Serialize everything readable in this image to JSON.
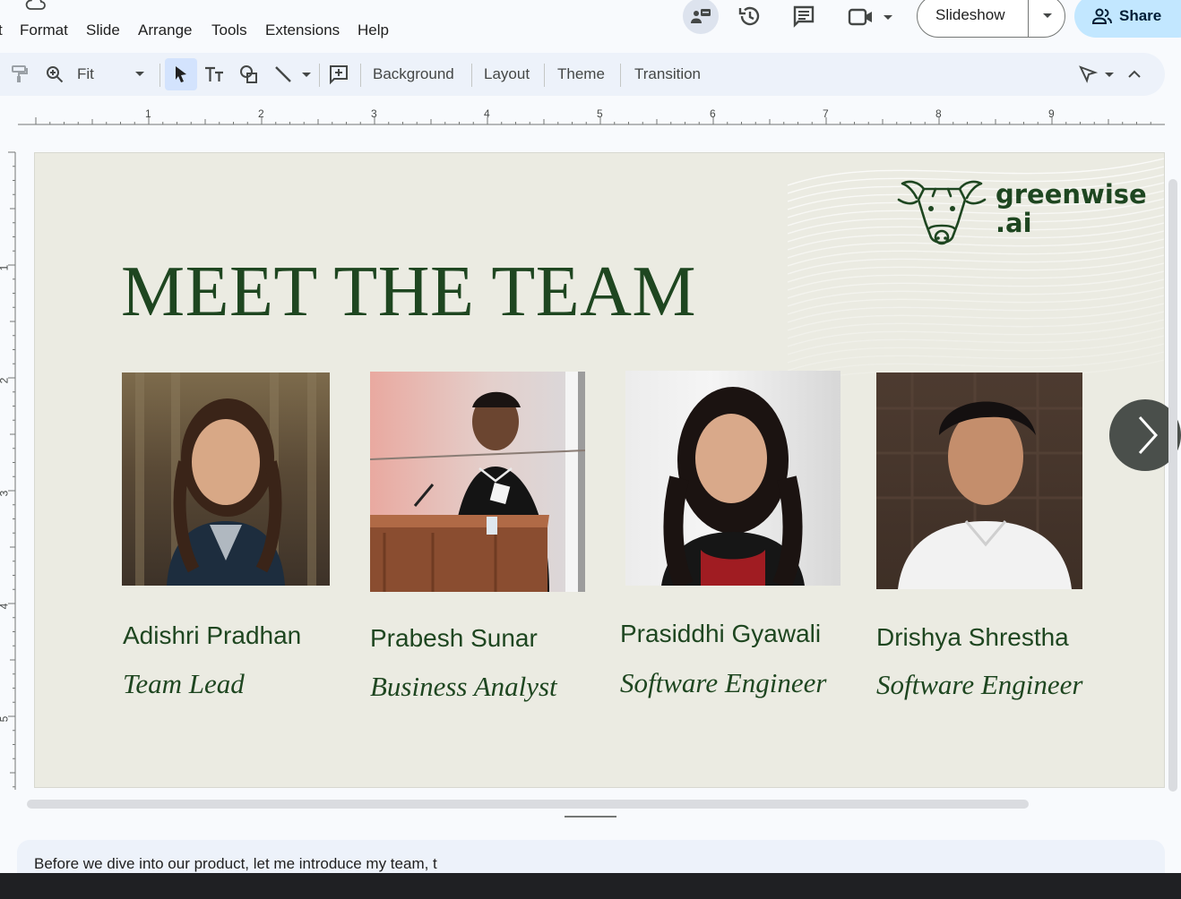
{
  "menu": {
    "edge_glyph": "t",
    "items": [
      "Format",
      "Slide",
      "Arrange",
      "Tools",
      "Extensions",
      "Help"
    ]
  },
  "header": {
    "slideshow_label": "Slideshow",
    "share_label": "Share"
  },
  "toolbar": {
    "zoom_value": "Fit",
    "background_label": "Background",
    "layout_label": "Layout",
    "theme_label": "Theme",
    "transition_label": "Transition"
  },
  "ruler": {
    "horizontal": [
      "1",
      "2",
      "3",
      "4",
      "5",
      "6",
      "7",
      "8",
      "9"
    ],
    "vertical": [
      "1",
      "2",
      "3",
      "4",
      "5"
    ]
  },
  "slide": {
    "brand_line1": "greenwise",
    "brand_line2": ".ai",
    "title": "MEET THE TEAM",
    "members": [
      {
        "name": "Adishri Pradhan",
        "role": "Team Lead"
      },
      {
        "name": "Prabesh Sunar",
        "role": "Business Analyst"
      },
      {
        "name": "Prasiddhi Gyawali",
        "role": "Software Engineer"
      },
      {
        "name": "Drishya Shrestha",
        "role": "Software Engineer"
      }
    ]
  },
  "notes": {
    "text": "Before we dive into our product, let me introduce my team, t"
  },
  "colors": {
    "accent": "#1e4620",
    "slide_bg": "#ebebe2",
    "share_bg": "#c2e7ff",
    "toolbar_bg": "#edf2fa"
  }
}
